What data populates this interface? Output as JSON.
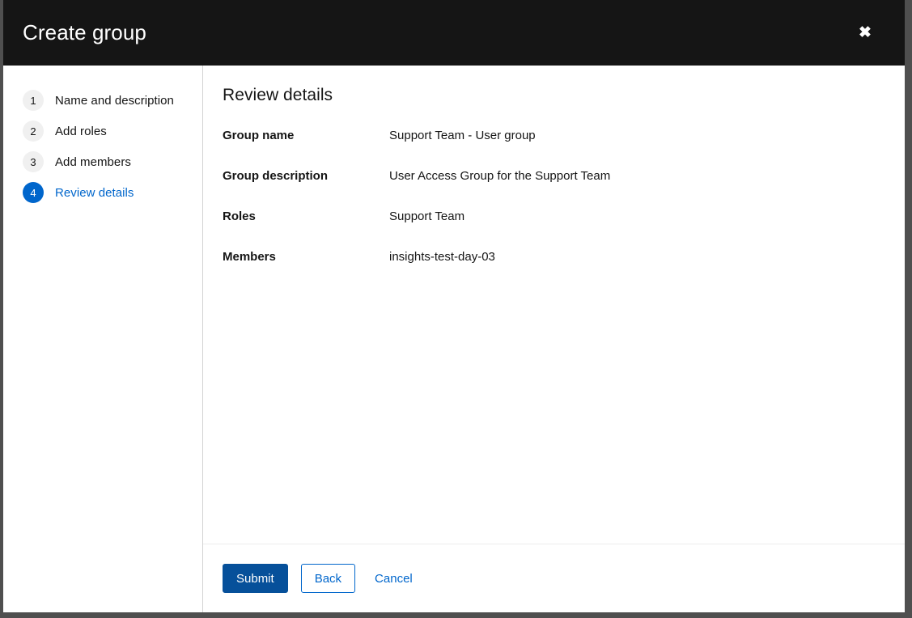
{
  "modal": {
    "title": "Create group",
    "close_icon": "close-icon",
    "close_glyph": "✖"
  },
  "wizard_nav": {
    "steps": [
      {
        "index": "1",
        "label": "Name and description",
        "active": false
      },
      {
        "index": "2",
        "label": "Add roles",
        "active": false
      },
      {
        "index": "3",
        "label": "Add members",
        "active": false
      },
      {
        "index": "4",
        "label": "Review details",
        "active": true
      }
    ]
  },
  "content": {
    "title": "Review details",
    "review": [
      {
        "term": "Group name",
        "description": "Support Team - User group"
      },
      {
        "term": "Group description",
        "description": "User Access Group for the Support Team"
      },
      {
        "term": "Roles",
        "description": "Support Team"
      },
      {
        "term": "Members",
        "description": "insights-test-day-03"
      }
    ]
  },
  "footer": {
    "submit_label": "Submit",
    "back_label": "Back",
    "cancel_label": "Cancel"
  },
  "colors": {
    "header_background": "#151515",
    "accent_blue": "#0066cc",
    "primary_button": "#06509a",
    "step_inactive": "#f0f0f0",
    "divider": "#d2d2d2",
    "backdrop_rail": "#4f4f4f"
  }
}
